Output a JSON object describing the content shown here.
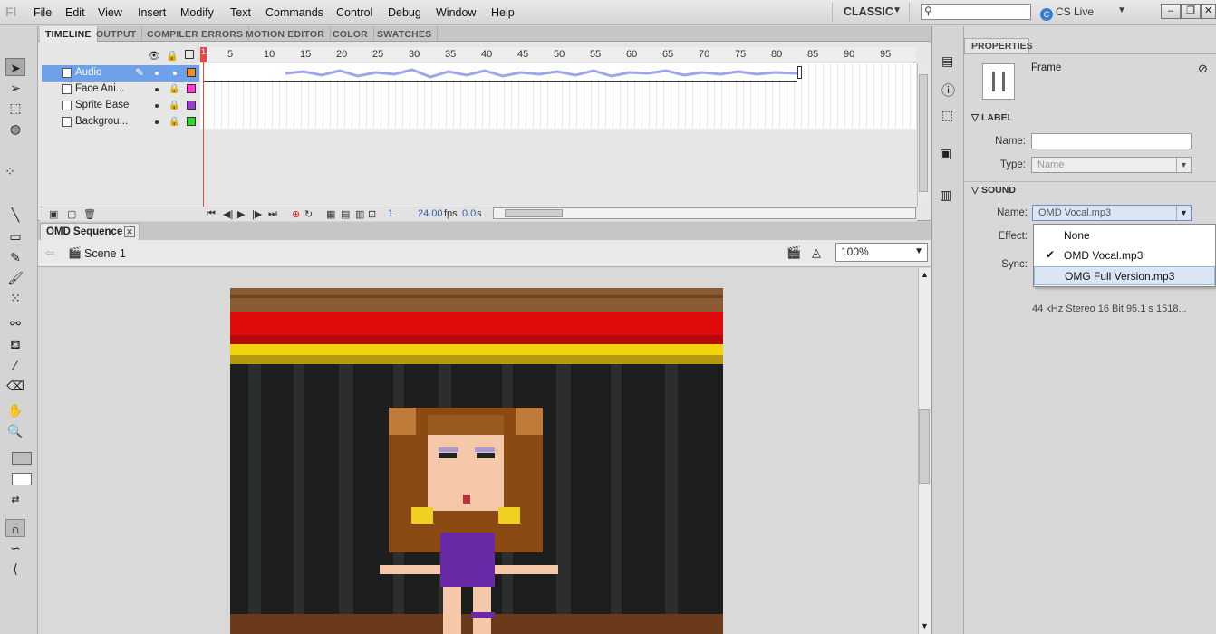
{
  "app": {
    "logo": "Fl"
  },
  "menubar": {
    "items": [
      "File",
      "Edit",
      "View",
      "Insert",
      "Modify",
      "Text",
      "Commands",
      "Control",
      "Debug",
      "Window",
      "Help"
    ],
    "workspace": "CLASSIC",
    "search_value": "",
    "cs_live": "CS Live"
  },
  "timeline_panel": {
    "tabs": [
      "TIMELINE",
      "OUTPUT",
      "COMPILER ERRORS",
      "MOTION EDITOR",
      "COLOR",
      "SWATCHES"
    ],
    "active_tab": "TIMELINE",
    "layers": [
      {
        "name": "Audio",
        "selected": true,
        "color": "#f28c1c"
      },
      {
        "name": "Face Ani...",
        "selected": false,
        "color": "#ff3ad3"
      },
      {
        "name": "Sprite Base",
        "selected": false,
        "color": "#9b3ad0"
      },
      {
        "name": "Backgrou...",
        "selected": false,
        "color": "#2fd42f"
      }
    ],
    "ruler_marks": [
      "1",
      "5",
      "10",
      "15",
      "20",
      "25",
      "30",
      "35",
      "40",
      "45",
      "50",
      "55",
      "60",
      "65",
      "70",
      "75",
      "80",
      "85",
      "90",
      "95"
    ],
    "current_frame": "1",
    "frame_rate": "24.00",
    "fps_label": "fps",
    "elapsed": "0.0",
    "elapsed_unit": "s"
  },
  "document": {
    "tab_title": "OMD Sequence",
    "scene": "Scene 1",
    "zoom": "100%"
  },
  "properties": {
    "tab": "PROPERTIES",
    "object_type": "Frame",
    "label_section": "LABEL",
    "label_name_label": "Name:",
    "label_name_value": "",
    "label_type_label": "Type:",
    "label_type_value": "Name",
    "sound_section": "SOUND",
    "sound_name_label": "Name:",
    "sound_name_value": "OMD Vocal.mp3",
    "effect_label": "Effect:",
    "sync_label": "Sync:",
    "sound_options": [
      {
        "label": "None",
        "checked": false,
        "highlighted": false
      },
      {
        "label": "OMD Vocal.mp3",
        "checked": true,
        "highlighted": false
      },
      {
        "label": "OMG Full Version.mp3",
        "checked": false,
        "highlighted": true
      }
    ],
    "sound_info": "44 kHz Stereo 16 Bit 95.1 s 1518..."
  }
}
